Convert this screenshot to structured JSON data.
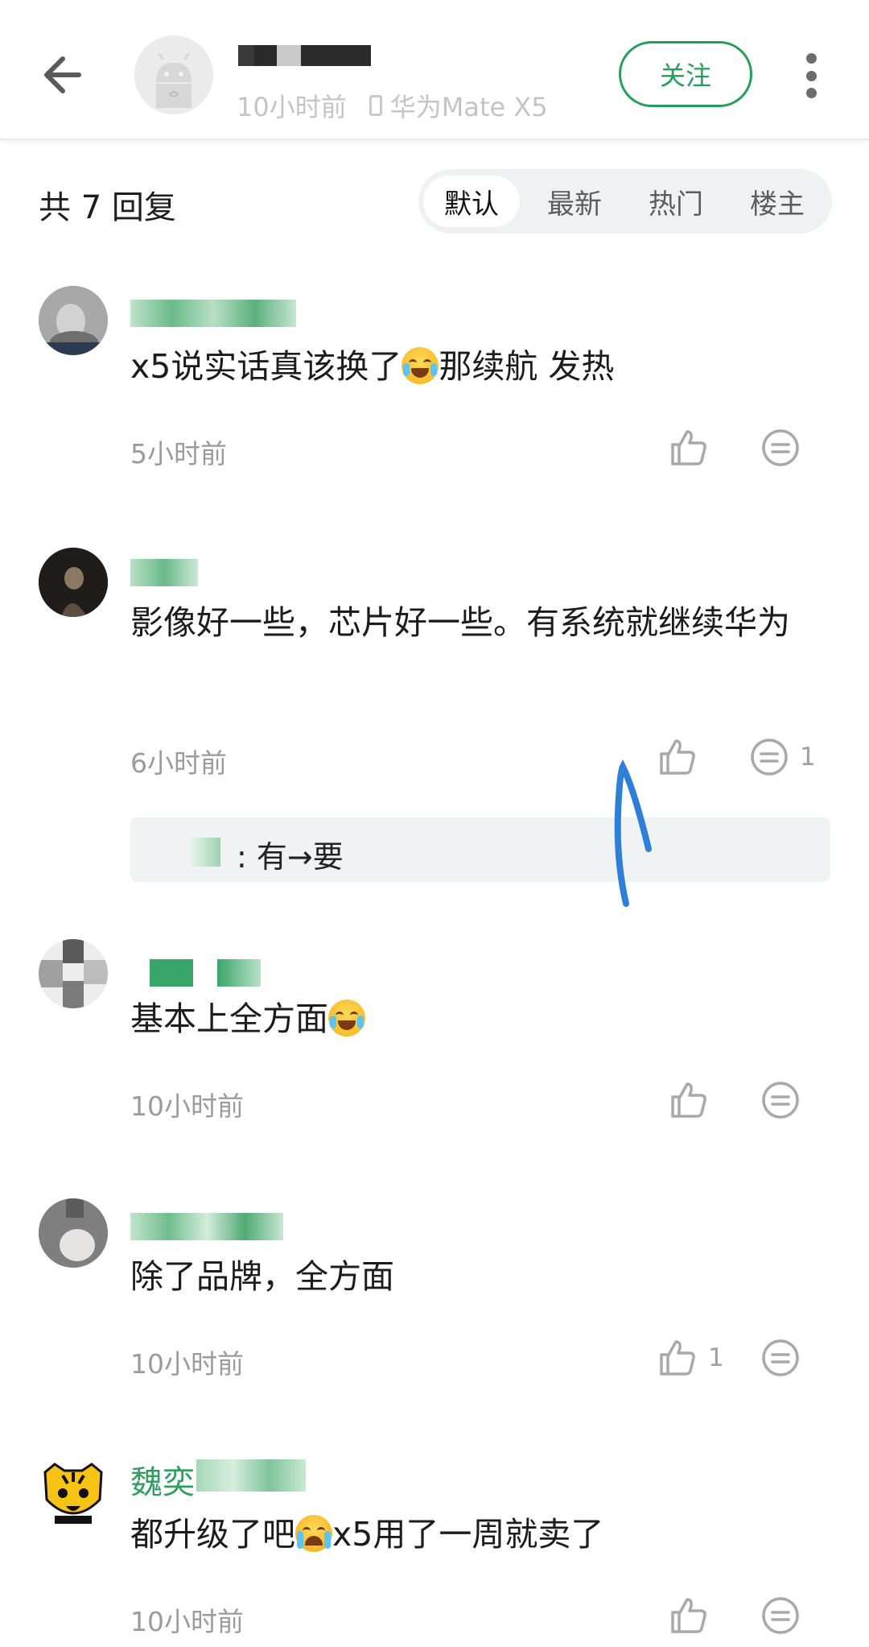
{
  "header": {
    "time": "10小时前",
    "device": "华为Mate X5",
    "follow_label": "关注"
  },
  "replies": {
    "count_label": "共 7 回复",
    "tabs": [
      "默认",
      "最新",
      "热门",
      "楼主"
    ],
    "active_tab": "默认"
  },
  "comments": [
    {
      "name": "",
      "text_before": "x5说实话真该换了",
      "emoji": "laugh-cry",
      "text_after": "那续航 发热",
      "time": "5小时前",
      "likes": "",
      "replies": ""
    },
    {
      "name": "",
      "text": "影像好一些，芯片好一些。有系统就继续华为",
      "time": "6小时前",
      "likes": "",
      "replies": "1",
      "sub_reply": {
        "prefix": ":",
        "text": "有→要"
      }
    },
    {
      "name": "",
      "text_before": "基本上全方面",
      "emoji": "laugh-cry",
      "text_after": "",
      "time": "10小时前",
      "likes": "",
      "replies": ""
    },
    {
      "name": "",
      "text": "除了品牌，全方面",
      "time": "10小时前",
      "likes": "1",
      "replies": ""
    },
    {
      "name": "魏奕",
      "text_before": "都升级了吧",
      "emoji": "crying",
      "text_after": "x5用了一周就卖了",
      "time": "10小时前",
      "likes": "",
      "replies": ""
    }
  ],
  "colors": {
    "accent": "#22a05a",
    "name_green": "#2f9e5e",
    "muted": "#9b9b9b",
    "annotation_blue": "#2d7fd8"
  },
  "icons": [
    "back-arrow-icon",
    "more-vertical-icon",
    "thumbs-up-icon",
    "reply-bubble-icon",
    "device-icon"
  ]
}
